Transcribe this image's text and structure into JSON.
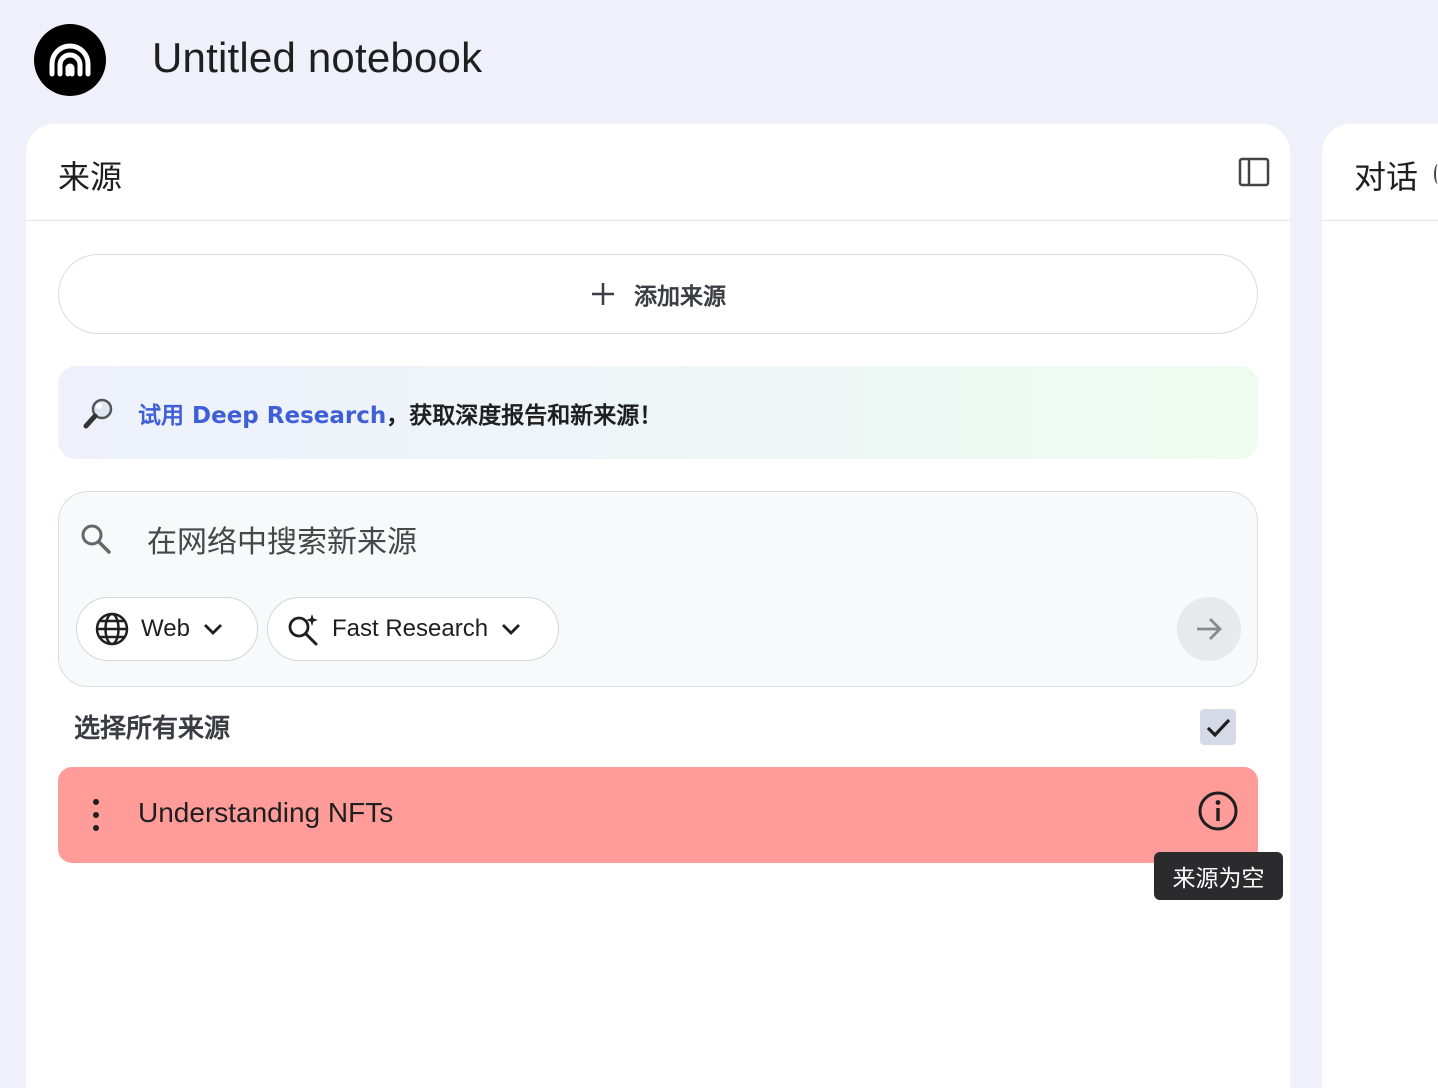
{
  "app": {
    "title": "Untitled notebook",
    "logo_icon": "notebook-logo-icon"
  },
  "sources_panel": {
    "title": "来源",
    "collapse_icon": "panel-collapse-icon",
    "add_source_label": "添加来源",
    "deep_research": {
      "link_text": "试用 Deep Research",
      "rest_text": "，获取深度报告和新来源！",
      "icon": "magnifier-emoji-icon"
    },
    "search": {
      "placeholder": "在网络中搜索新来源",
      "value": "",
      "web_chip_label": "Web",
      "research_chip_label": "Fast Research"
    },
    "select_all_label": "选择所有来源",
    "select_all_checked": true,
    "sources": [
      {
        "title": "Understanding NFTs",
        "highlight_color": "#ff9c9a"
      }
    ],
    "tooltip": "来源为空"
  },
  "chat_panel": {
    "title": "对话"
  },
  "colors": {
    "background": "#eff0fa",
    "link": "#3f5fd8",
    "source_error": "#ff9c9a"
  }
}
